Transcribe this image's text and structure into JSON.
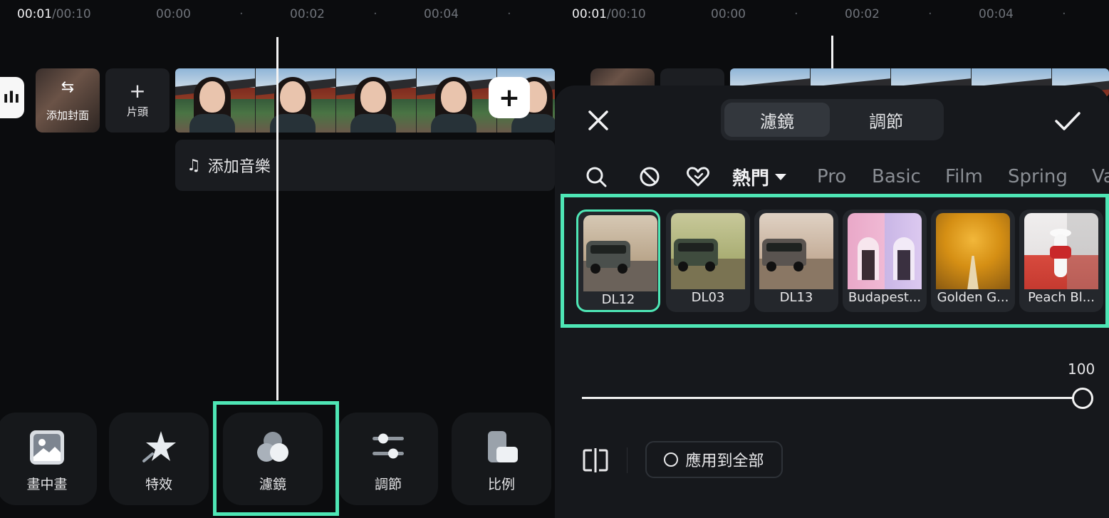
{
  "left_screen": {
    "timecode_current": "00:01",
    "timecode_total": "/00:10",
    "ruler_marks": [
      "00:00",
      "00:02",
      "00:04"
    ],
    "track": {
      "cover_label": "添加封面",
      "intro_label": "片頭",
      "add_music_label": "添加音樂"
    },
    "toolbar": [
      {
        "label": "畫中畫",
        "icon": "picture-in-picture-icon"
      },
      {
        "label": "特效",
        "icon": "effects-star-icon"
      },
      {
        "label": "濾鏡",
        "icon": "filter-circles-icon"
      },
      {
        "label": "調節",
        "icon": "adjust-sliders-icon"
      },
      {
        "label": "比例",
        "icon": "ratio-icon"
      }
    ],
    "highlighted_tool": "濾鏡"
  },
  "right_screen": {
    "timecode_current": "00:01",
    "timecode_total": "/00:10",
    "ruler_marks": [
      "00:00",
      "00:02",
      "00:04"
    ],
    "tabs": [
      {
        "label": "濾鏡",
        "active": true
      },
      {
        "label": "調節",
        "active": false
      }
    ],
    "categories": [
      {
        "label": "熱門",
        "active": true
      },
      {
        "label": "Pro",
        "active": false
      },
      {
        "label": "Basic",
        "active": false
      },
      {
        "label": "Film",
        "active": false
      },
      {
        "label": "Spring",
        "active": false
      },
      {
        "label": "Va",
        "active": false
      }
    ],
    "filters": [
      {
        "name": "DL12",
        "selected": true
      },
      {
        "name": "DL03",
        "selected": false
      },
      {
        "name": "DL13",
        "selected": false
      },
      {
        "name": "Budapest...",
        "selected": false
      },
      {
        "name": "Golden G...",
        "selected": false
      },
      {
        "name": "Peach Bl...",
        "selected": false
      }
    ],
    "intensity": 100,
    "intensity_label": "100",
    "apply_all_label": "應用到全部"
  },
  "colors": {
    "highlight": "#4ee6b5",
    "background": "#0b0c0e",
    "sheet": "#16181c"
  }
}
